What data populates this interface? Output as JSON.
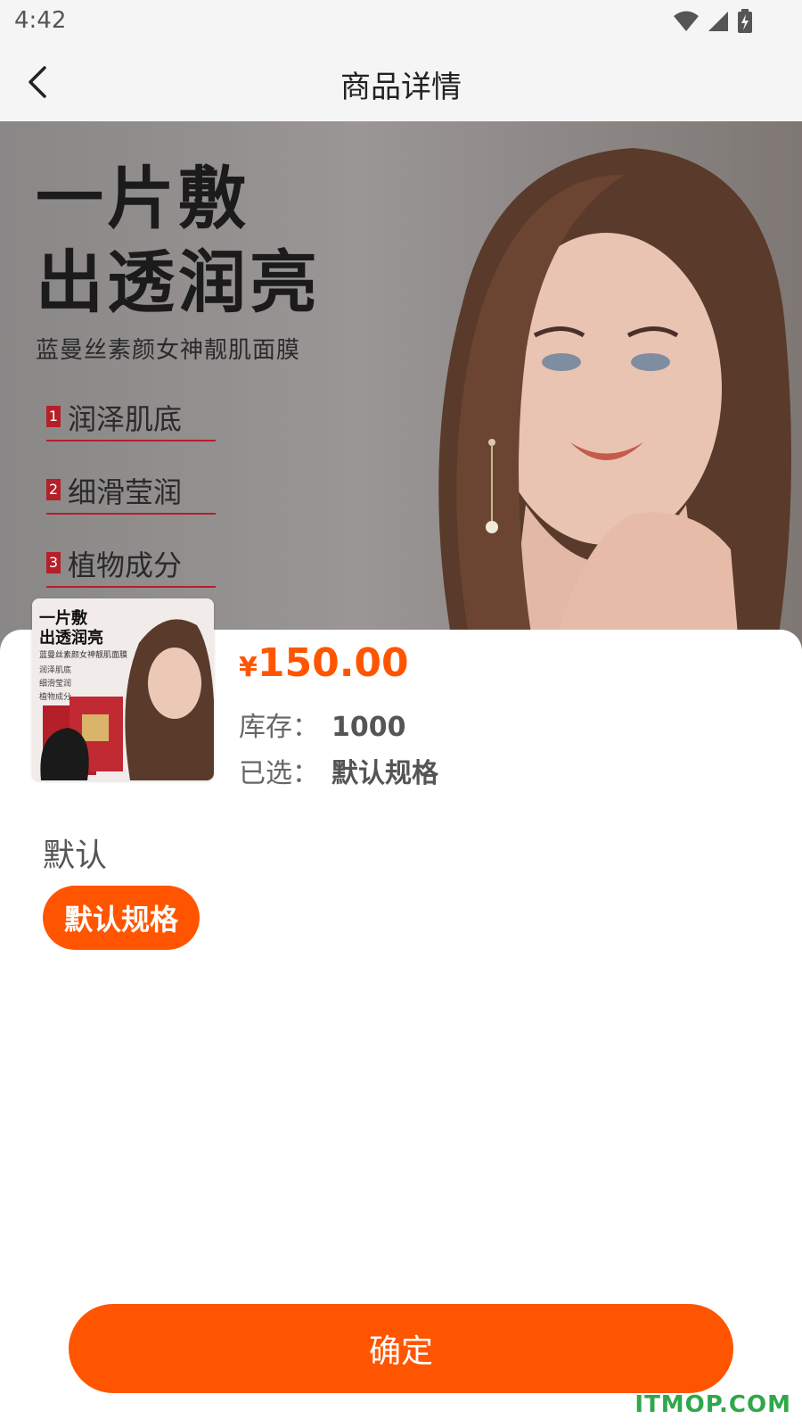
{
  "status_bar": {
    "time": "4:42"
  },
  "header": {
    "title": "商品详情"
  },
  "banner": {
    "headline_1": "一片敷",
    "headline_2": "出透润亮",
    "subtitle": "蓝曼丝素颜女神靓肌面膜",
    "features": [
      {
        "num": "1",
        "label": "润泽肌底"
      },
      {
        "num": "2",
        "label": "细滑莹润"
      },
      {
        "num": "3",
        "label": "植物成分"
      }
    ]
  },
  "product": {
    "currency": "¥",
    "price": "150.00",
    "stock_label": "库存：",
    "stock_value": "1000",
    "selected_label": "已选：",
    "selected_value": "默认规格"
  },
  "spec": {
    "group_title": "默认",
    "option_label": "默认规格"
  },
  "confirm_label": "确定",
  "watermark": "ITMOP.COM",
  "colors": {
    "accent": "#ff5500",
    "watermark": "#2ea84a"
  }
}
